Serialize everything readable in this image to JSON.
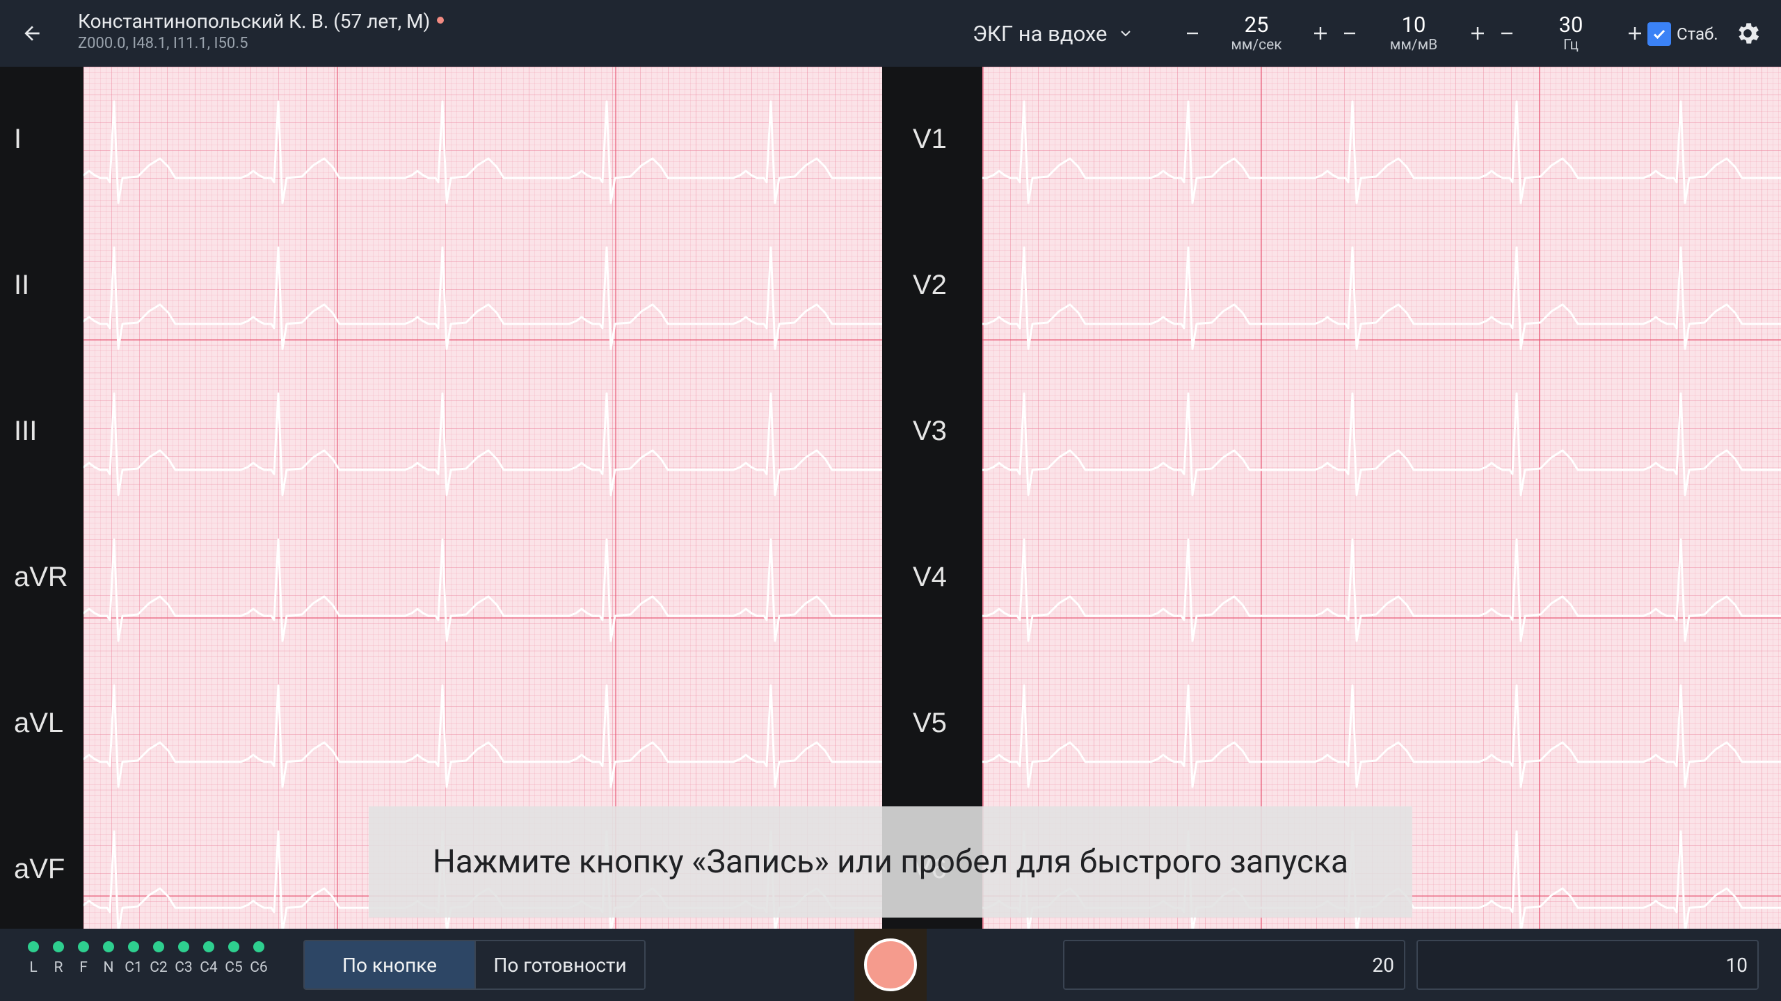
{
  "header": {
    "patient_name": "Константинопольский К. В. (57 лет, М)",
    "diagnosis_codes": "Z000.0, I48.1, I11.1, I50.5",
    "mode": "ЭКГ на вдохе",
    "speed": {
      "value": "25",
      "unit": "мм/сек"
    },
    "gain": {
      "value": "10",
      "unit": "мм/мВ"
    },
    "filter": {
      "value": "30",
      "unit": "Гц"
    },
    "stab_label": "Стаб.",
    "stab_checked": true
  },
  "leads": {
    "left": [
      "I",
      "II",
      "III",
      "aVR",
      "aVL",
      "aVF"
    ],
    "right": [
      "V1",
      "V2",
      "V3",
      "V4",
      "V5",
      "V6"
    ]
  },
  "hint": "Нажмите кнопку «Запись» или пробел для быстрого запуска",
  "footer": {
    "electrodes": [
      "L",
      "R",
      "F",
      "N",
      "C1",
      "C2",
      "C3",
      "C4",
      "C5",
      "C6"
    ],
    "trigger_options": [
      "По кнопке",
      "По готовности"
    ],
    "trigger_selected": "По кнопке",
    "field_1": "20",
    "field_2": "10"
  },
  "colors": {
    "bar_bg": "#1f2631",
    "electrode_ok": "#2ecf8f",
    "record_button": "#f59b8d",
    "accent": "#3b82f6"
  }
}
